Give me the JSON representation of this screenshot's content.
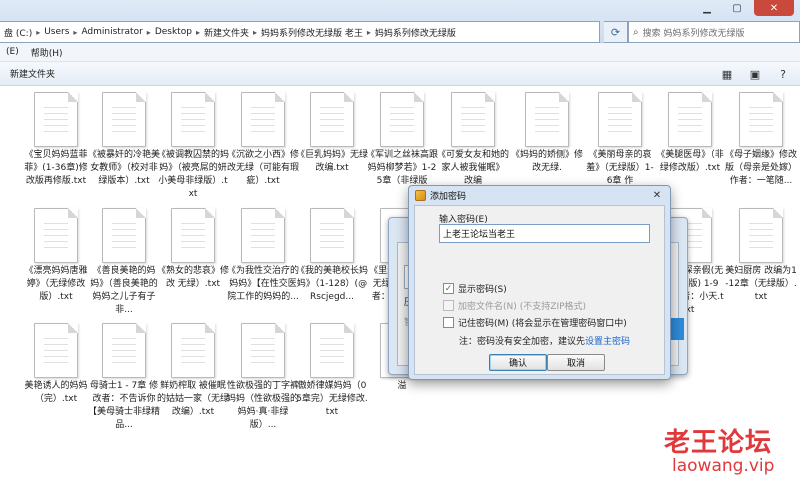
{
  "address": {
    "crumbs": [
      "盘 (C:)",
      "Users",
      "Administrator",
      "Desktop",
      "新建文件夹",
      "妈妈系列修改无绿版 老王",
      "妈妈系列修改无绿版"
    ],
    "search_placeholder": "搜索 妈妈系列修改无绿版"
  },
  "menu": {
    "items": [
      "(E)",
      "帮助(H)"
    ]
  },
  "toolbar": {
    "new_folder": "新建文件夹"
  },
  "files": [
    {
      "label": "《宝贝妈妈蓝菲菲》(1-36章)修改版再修版.txt"
    },
    {
      "label": "《被暴奸的冷艳美女教师》（校对非绿版本）.txt"
    },
    {
      "label": "《被调教囚禁的妈妈》（被亮屌的妍小美母非绿版）.txt"
    },
    {
      "label": "《沉欲之小西》修改无绿（可能有瑕疵）.txt"
    },
    {
      "label": "《巨乳妈妈》无绿改编.txt"
    },
    {
      "label": "《军训之丝袜高跟妈妈柳梦若》1-25章（非绿版"
    },
    {
      "label": "《可爱女友和她的家人被我催眠》 改编"
    },
    {
      "label": "《妈妈的娇侧》修改无绿."
    },
    {
      "label": "《美丽母亲的哀羞》（无绿版）1-6章 作"
    },
    {
      "label": "《美腿医母》（非绿修改版）.txt"
    },
    {
      "label": "《母子姻缘》修改版（母亲是处嫁）作者：一笔随..."
    },
    {
      "label": "《漂亮妈妈唐雅婷》（无绿修改版）.txt"
    },
    {
      "label": "《善良美艳的妈妈》（善良美艳的妈妈之儿子有子 非..."
    },
    {
      "label": "《熟女的悲哀》修改 无绿）.txt"
    },
    {
      "label": "《为我性交治疗的妈妈》【在性交医院工作的妈妈的..."
    },
    {
      "label": "《我的美艳校长妈妈》（1-128）(@Rscjegd..."
    },
    {
      "label": "《里生之家 自改无绿认证】【作者：不详】.txt"
    },
    {
      "label": "被我催眠受精的美母教师（非绿版）.txt"
    },
    {
      "label": "炼狱天使去掉绿帽.txt"
    },
    {
      "label": "乱伦不成妈妈被迷奸怀孕（非绿版）.txt"
    },
    {
      "label": "妈咪的探亲假(无雷加强版) 1-9(完)作者：小天.txt"
    },
    {
      "label": "美妇厨房 改编为1-12章（无绿版）.txt"
    },
    {
      "label": "美艳诱人的妈妈（完）.txt"
    },
    {
      "label": "母骑士1 - 7章 修改者：不告诉你【美母骑士非绿精品..."
    },
    {
      "label": "鲜奶榨取 被催眠的姑姑一家（无绿改编）.txt"
    },
    {
      "label": "性欲极强的丁字裤妈妈（性欲极强的妈妈·真·非绿版）..."
    },
    {
      "label": "傲娇律媒妈妈（05章完）无绿修改.txt"
    },
    {
      "label": "溢"
    }
  ],
  "dialog": {
    "title": "添加密码",
    "close": "✕",
    "password_label": "输入密码(E)",
    "password_value": "上老王论坛当老王",
    "show_password": "显示密码(S)",
    "encrypt_filename": "加密文件名(N)",
    "encrypt_filename_note": "(不支持ZIP格式)",
    "remember_password": "记住密码(M)",
    "remember_note": "(将会显示在管理密码窗口中)",
    "note_prefix": "注：密码没有安全加密，建议先",
    "note_link": "设置主密码",
    "ok": "确认",
    "cancel": "取消"
  },
  "bg_dialog": {
    "label_1": "压",
    "label_2": "智",
    "field": "妈"
  },
  "watermark": {
    "title": "老王论坛",
    "url": "laowang.vip"
  },
  "colors": {
    "accent": "#1c63c7",
    "watermark": "#e0383b",
    "check": "#3a8a2a"
  }
}
